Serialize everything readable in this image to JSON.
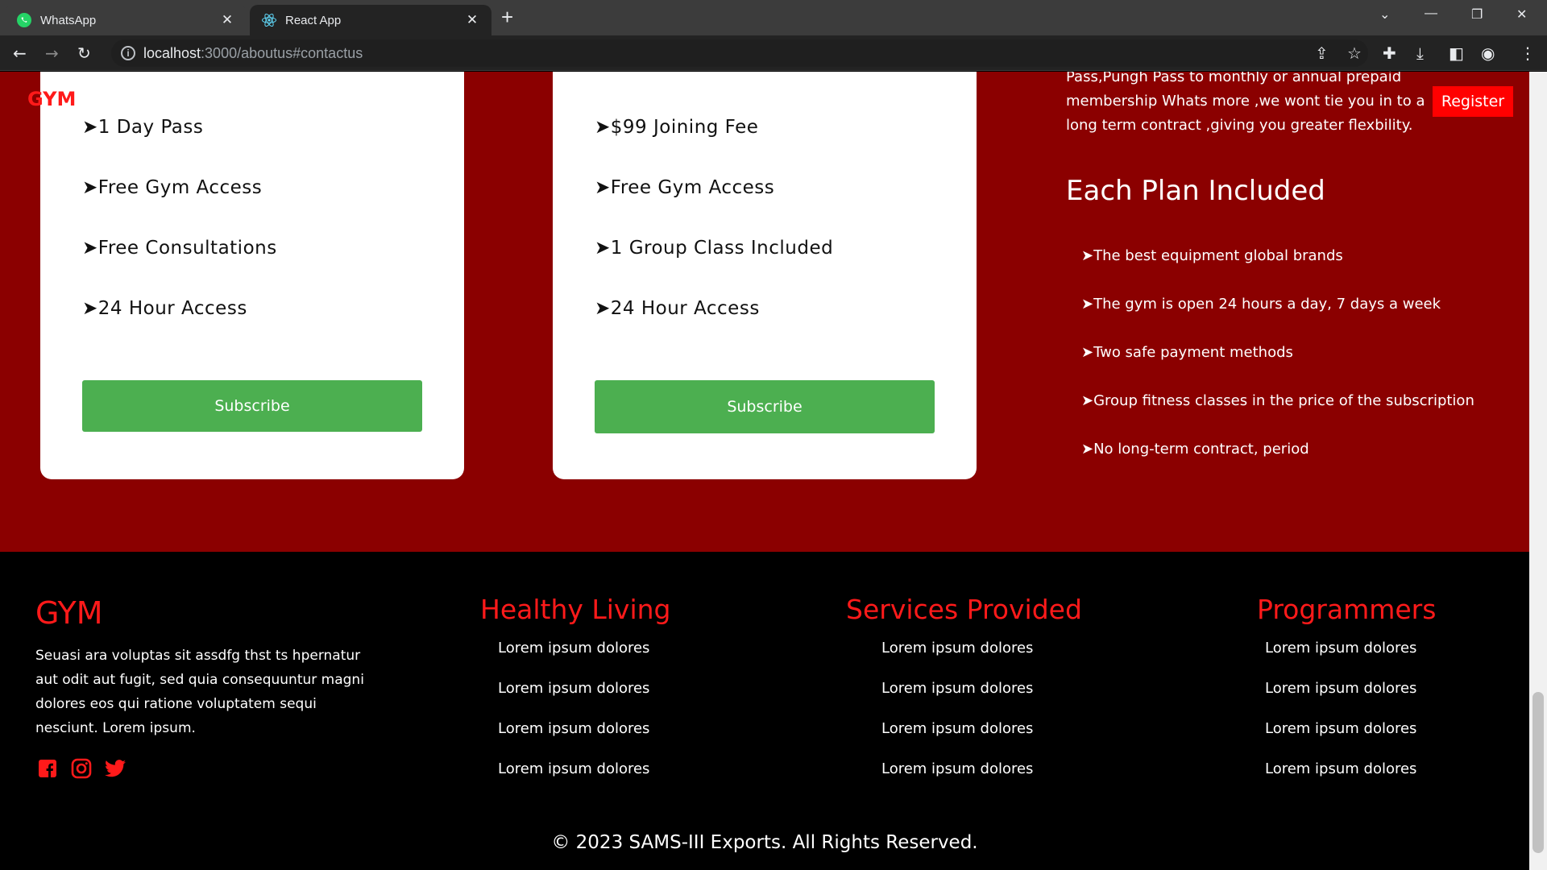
{
  "browser": {
    "tabs": [
      {
        "title": "WhatsApp",
        "icon": "whatsapp-icon"
      },
      {
        "title": "React App",
        "icon": "react-icon"
      }
    ],
    "url_host": "localhost",
    "url_rest": ":3000/aboutus#contactus"
  },
  "header": {
    "brand": "GYM",
    "register_label": "Register"
  },
  "plans": [
    {
      "features": [
        "➤1 Day Pass",
        "➤Free Gym Access",
        "➤Free Consultations",
        "➤24 Hour Access"
      ],
      "subscribe_label": "Subscribe"
    },
    {
      "features": [
        "➤$99 Joining Fee",
        "➤Free Gym Access",
        "➤1 Group Class Included",
        "➤24 Hour Access"
      ],
      "subscribe_label": "Subscribe"
    }
  ],
  "info": {
    "intro_text": "Pass,Pungh Pass to monthly or annual prepaid membership Whats more ,we wont tie you in to a long term contract ,giving you greater flexbility.",
    "heading": "Each Plan Included",
    "items": [
      "➤The best equipment global brands",
      "➤The gym is open 24 hours a day, 7 days a week",
      "➤Two safe payment methods",
      "➤Group fitness classes in the price of the subscription",
      "➤No long-term contract, period"
    ]
  },
  "footer": {
    "brand": "GYM",
    "description": "Seuasi ara voluptas sit assdfg thst ts hpernatur aut odit aut fugit, sed quia consequuntur magni dolores eos qui ratione voluptatem sequi nesciunt. Lorem ipsum.",
    "social": [
      "facebook-icon",
      "instagram-icon",
      "twitter-icon"
    ],
    "columns": [
      {
        "title": "Healthy Living",
        "links": [
          "Lorem ipsum dolores",
          "Lorem ipsum dolores",
          "Lorem ipsum dolores",
          "Lorem ipsum dolores"
        ]
      },
      {
        "title": "Services Provided",
        "links": [
          "Lorem ipsum dolores",
          "Lorem ipsum dolores",
          "Lorem ipsum dolores",
          "Lorem ipsum dolores"
        ]
      },
      {
        "title": "Programmers",
        "links": [
          "Lorem ipsum dolores",
          "Lorem ipsum dolores",
          "Lorem ipsum dolores",
          "Lorem ipsum dolores"
        ]
      }
    ],
    "copyright": "© 2023 SAMS-III Exports. All Rights Reserved."
  },
  "colors": {
    "brand_red": "#ff1a1a",
    "section_bg": "#8b0000",
    "subscribe_green": "#4caf50"
  }
}
